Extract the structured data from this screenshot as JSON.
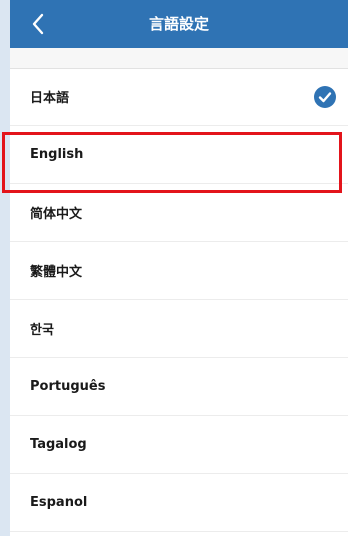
{
  "header": {
    "title": "言語設定",
    "back_icon": "chevron-left-icon",
    "background": "#2f73b4"
  },
  "languages": [
    {
      "label": "日本語",
      "selected": true
    },
    {
      "label": "English",
      "selected": false,
      "highlighted": true
    },
    {
      "label": "简体中文",
      "selected": false
    },
    {
      "label": "繁體中文",
      "selected": false
    },
    {
      "label": "한국",
      "selected": false
    },
    {
      "label": "Português",
      "selected": false
    },
    {
      "label": "Tagalog",
      "selected": false
    },
    {
      "label": "Espanol",
      "selected": false
    }
  ],
  "colors": {
    "accent": "#2f73b4",
    "highlight": "#e3141b"
  },
  "selected_icon": "check-circle-icon"
}
